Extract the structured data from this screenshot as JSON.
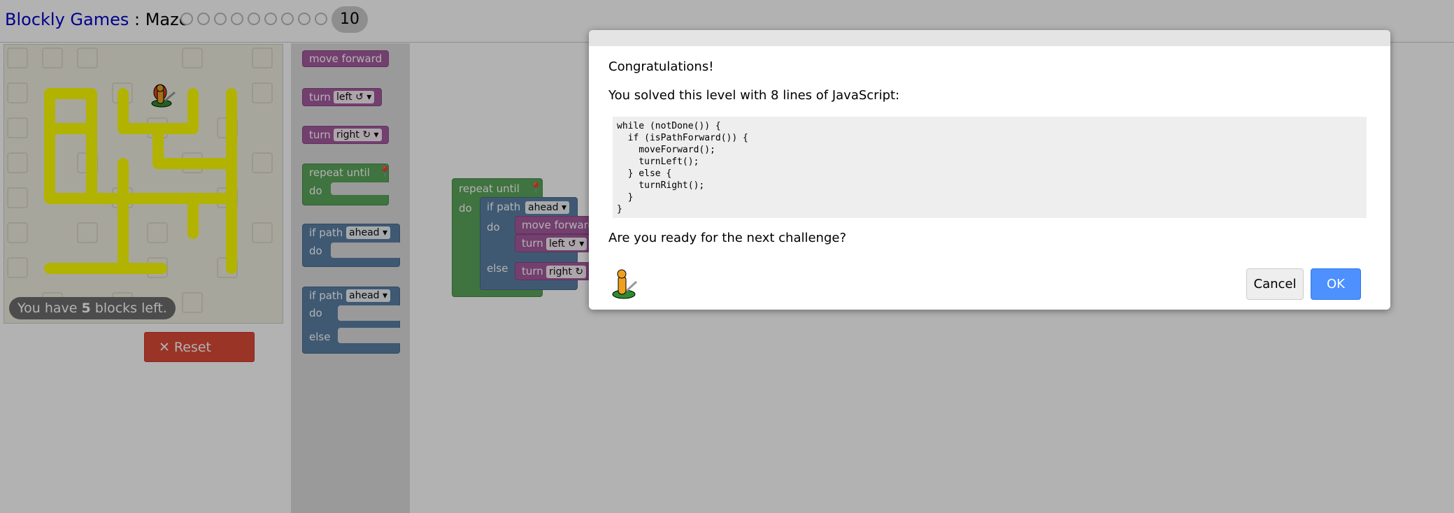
{
  "header": {
    "app_name": "Blockly Games",
    "separator": " : ",
    "game_name": "Maze",
    "current_level": "10",
    "level_count": 10
  },
  "maze": {
    "blocks_left_prefix": "You have ",
    "blocks_left_count": "5",
    "blocks_left_suffix": " blocks left.",
    "reset_icon": "close-icon",
    "reset_label": "Reset"
  },
  "toolbox": {
    "move_forward": "move forward",
    "turn_left": {
      "label": "turn",
      "dropdown": "left ↺ ▾"
    },
    "turn_right": {
      "label": "turn",
      "dropdown": "right ↻ ▾"
    },
    "repeat_until": {
      "label": "repeat until",
      "do": "do",
      "icon": "map-marker-icon"
    },
    "if_path": {
      "label": "if path",
      "dropdown": "ahead ▾",
      "do": "do"
    },
    "if_else_path": {
      "label": "if path",
      "dropdown": "ahead ▾",
      "do": "do",
      "else": "else"
    }
  },
  "workspace": {
    "repeat_label": "repeat until",
    "repeat_do": "do",
    "if_label": "if path",
    "if_dropdown": "ahead ▾",
    "if_do": "do",
    "if_else": "else",
    "move_forward": "move forward",
    "turn_label_1": "turn",
    "turn_left_dropdown": "left ↺ ▾",
    "turn_label_2": "turn",
    "turn_right_dropdown": "right ↻"
  },
  "dialog": {
    "congrats": "Congratulations!",
    "solved": "You solved this level with 8 lines of JavaScript:",
    "code_lines": [
      "while (notDone()) {",
      "  if (isPathForward()) {",
      "    moveForward();",
      "    turnLeft();",
      "  } else {",
      "    turnRight();",
      "  }",
      "}"
    ],
    "ready": "Are you ready for the next challenge?",
    "cancel_label": "Cancel",
    "ok_label": "OK"
  },
  "colors": {
    "motion_block": "#a55b9f",
    "loop_block": "#5ba55b",
    "logic_block": "#5b80a5",
    "path": "#ffff00",
    "reset_button": "#dd4b39",
    "ok_button": "#4d90fe",
    "link": "#0000cc"
  }
}
